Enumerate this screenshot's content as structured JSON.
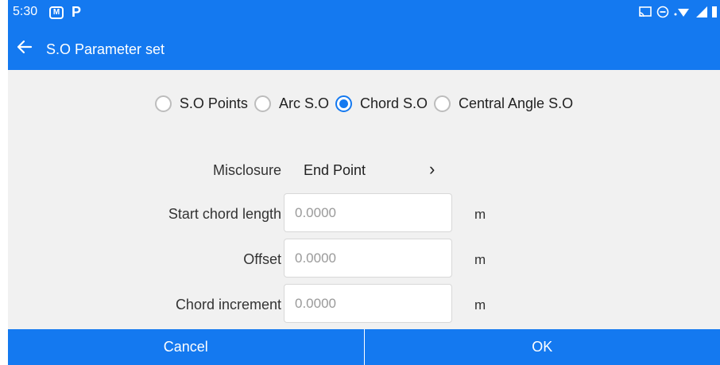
{
  "status_bar": {
    "time": "5:30",
    "icons": [
      "mail-icon",
      "p-app-icon",
      "cast-icon",
      "dnd-icon",
      "wifi-icon",
      "signal-icon",
      "battery-icon"
    ]
  },
  "app_bar": {
    "title": "S.O Parameter set"
  },
  "stakeout_types": {
    "options": [
      {
        "label": "S.O Points",
        "selected": false
      },
      {
        "label": "Arc S.O",
        "selected": false
      },
      {
        "label": "Chord S.O",
        "selected": true
      },
      {
        "label": "Central Angle S.O",
        "selected": false
      }
    ]
  },
  "misclosure": {
    "label": "Misclosure",
    "value": "End Point"
  },
  "fields": [
    {
      "label": "Start chord length",
      "placeholder": "0.0000",
      "unit": "m"
    },
    {
      "label": "Offset",
      "placeholder": "0.0000",
      "unit": "m"
    },
    {
      "label": "Chord increment",
      "placeholder": "0.0000",
      "unit": "m"
    }
  ],
  "buttons": {
    "cancel": "Cancel",
    "ok": "OK"
  },
  "colors": {
    "primary": "#1479f0",
    "background": "#f1f1f1"
  }
}
